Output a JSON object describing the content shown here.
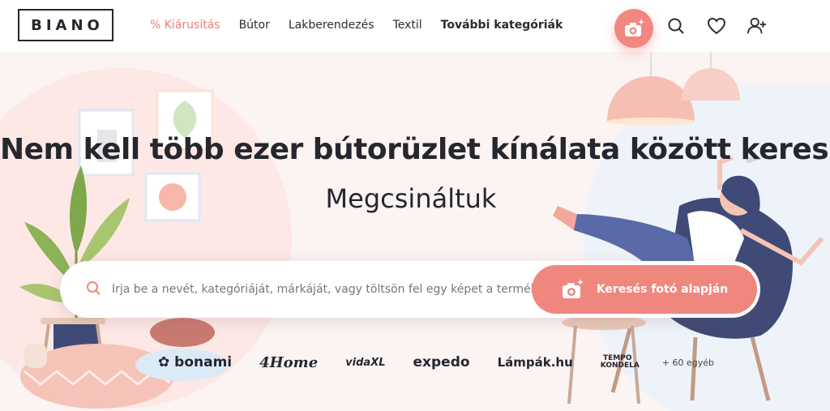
{
  "header": {
    "logo": "BIANO",
    "nav": [
      {
        "label": "% Kiárusítás",
        "name": "nav-sale"
      },
      {
        "label": "Bútor",
        "name": "nav-butor"
      },
      {
        "label": "Lakberendezés",
        "name": "nav-lakberendezes"
      },
      {
        "label": "Textil",
        "name": "nav-textil"
      },
      {
        "label": "További kategóriák",
        "name": "nav-more"
      }
    ],
    "icons": [
      "camera-icon",
      "search-icon",
      "heart-icon",
      "user-add-icon"
    ]
  },
  "hero": {
    "title": "Nem kell több ezer bútorüzlet kínálata között keresnie",
    "subtitle": "Megcsináltuk"
  },
  "search": {
    "placeholder": "Írja be a nevét, kategóriáját, márkáját, vagy töltsön fel egy képet a termékről ...",
    "photo_button_label": "Keresés fotó alapján"
  },
  "partners": {
    "bonami": "bonami",
    "fourhome": "4Home",
    "vidaxl": "vidaXL",
    "expedo": "expedo",
    "lampak": "Lámpák.hu",
    "tempo": "TEMPO KONDELA",
    "more": "+ 60 egyéb"
  },
  "colors": {
    "accent": "#f0877f",
    "text": "#26262e",
    "hero_bg": "#fbf4f3"
  }
}
